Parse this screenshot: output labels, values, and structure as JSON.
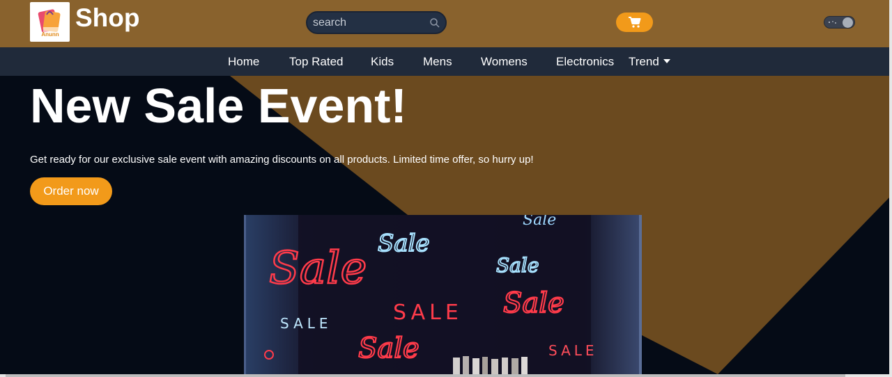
{
  "header": {
    "brand": "Shop",
    "logo_text": "Anunn",
    "search": {
      "placeholder": "search",
      "value": ""
    },
    "icons": [
      "search-icon",
      "cart-icon",
      "theme-toggle"
    ]
  },
  "nav": {
    "items": [
      {
        "label": "Home"
      },
      {
        "label": "Top Rated"
      },
      {
        "label": "Kids"
      },
      {
        "label": "Mens"
      },
      {
        "label": "Womens"
      },
      {
        "label": "Electronics"
      },
      {
        "label": "Trend"
      }
    ]
  },
  "hero": {
    "title": "New Sale Event!",
    "subtitle": "Get ready for our exclusive sale event with amazing discounts on all products. Limited time offer, so hurry up!",
    "cta_label": "Order now",
    "image_signs": [
      "Sale",
      "Sale",
      "Sale",
      "SALE",
      "Sale",
      "SALE",
      "Sale",
      "SALE",
      "Sale"
    ]
  },
  "colors": {
    "header_bg": "#89622d",
    "nav_bg": "#202a3a",
    "hero_dark": "#050b16",
    "hero_brown": "#6b4a1f",
    "accent_orange": "#f29a1a"
  }
}
